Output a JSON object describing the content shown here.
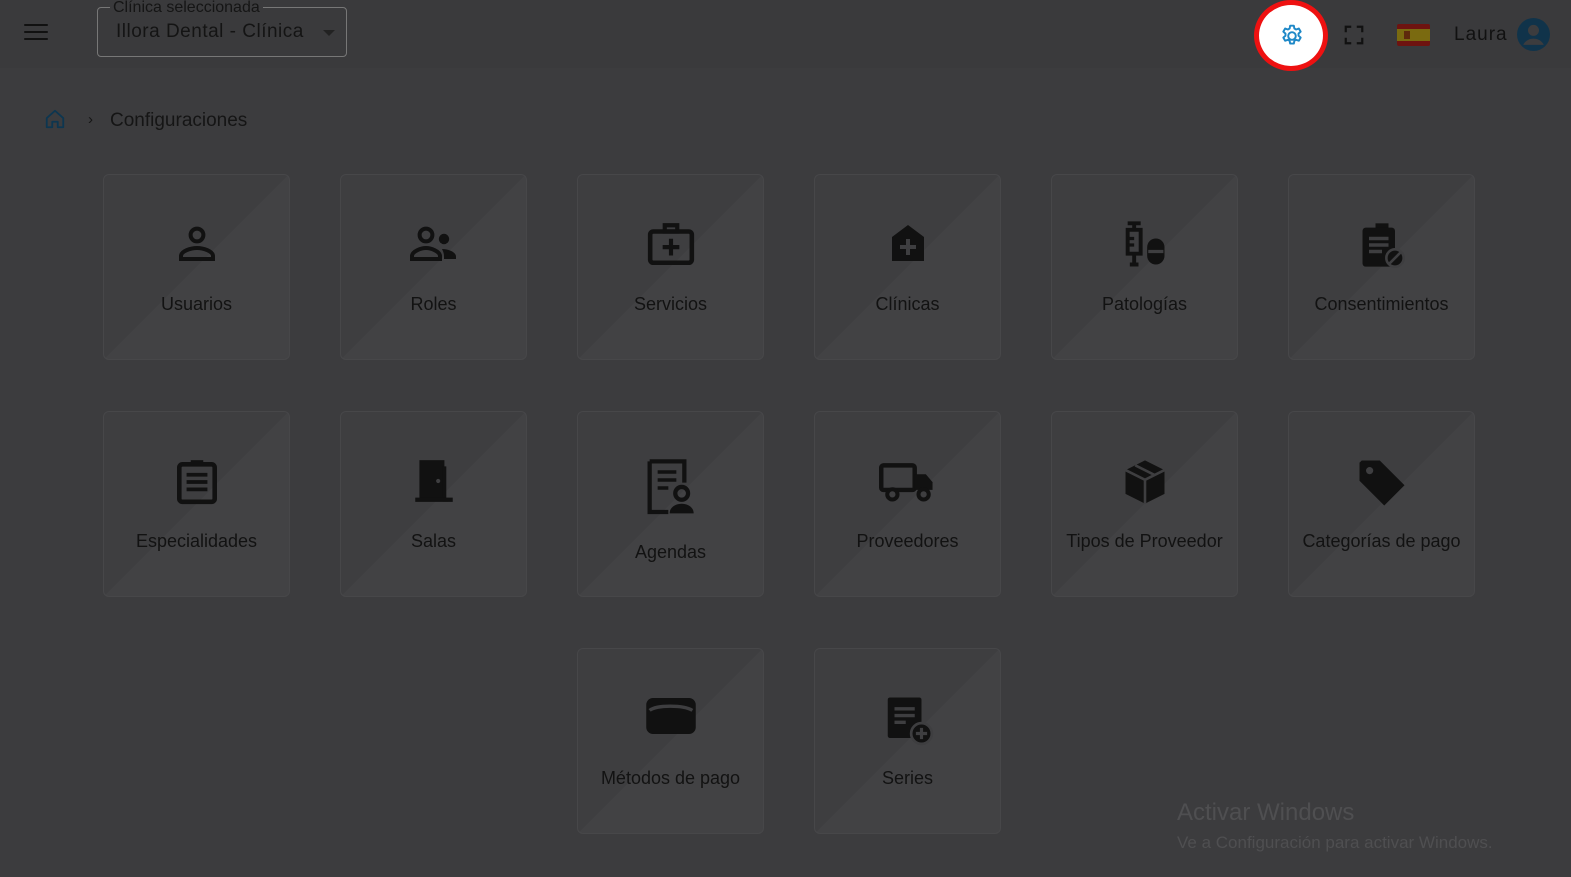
{
  "header": {
    "clinic_select": {
      "legend": "Clínica seleccionada",
      "value": "Illora Dental - Clínica"
    },
    "user_name": "Laura"
  },
  "breadcrumb": {
    "separator": "›",
    "current": "Configuraciones"
  },
  "cards": [
    {
      "label": "Usuarios",
      "icon": "person-icon"
    },
    {
      "label": "Roles",
      "icon": "people-icon"
    },
    {
      "label": "Servicios",
      "icon": "medical-bag-icon"
    },
    {
      "label": "Clínicas",
      "icon": "clinic-house-icon"
    },
    {
      "label": "Patologías",
      "icon": "vaccine-pill-icon"
    },
    {
      "label": "Consentimientos",
      "icon": "clipboard-pill-icon"
    },
    {
      "label": "Especialidades",
      "icon": "clipboard-list-icon"
    },
    {
      "label": "Salas",
      "icon": "door-icon"
    },
    {
      "label": "Agendas",
      "icon": "contact-page-icon"
    },
    {
      "label": "Proveedores",
      "icon": "truck-icon"
    },
    {
      "label": "Tipos de Proveedor",
      "icon": "package-icon"
    },
    {
      "label": "Categorías de pago",
      "icon": "tag-icon"
    },
    {
      "label": "Métodos de pago",
      "icon": "wallet-icon"
    },
    {
      "label": "Series",
      "icon": "document-add-icon"
    }
  ],
  "watermark": {
    "title": "Activar Windows",
    "subtitle": "Ve a Configuración para activar Windows."
  },
  "colors": {
    "gear_accent": "#1e88c7",
    "highlight_ring": "#e11111"
  }
}
